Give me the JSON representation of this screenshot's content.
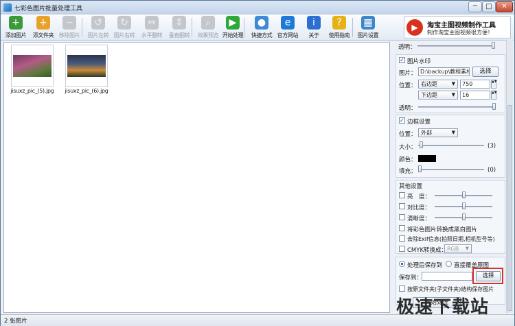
{
  "window": {
    "title": "七彩色图片批量处理工具",
    "min": "─",
    "max": "□",
    "close": "✕"
  },
  "toolbar": [
    {
      "label": "添加图片",
      "icon": "add-image-icon",
      "glyph": "+",
      "color": "#3a9a3a",
      "disabled": false
    },
    {
      "label": "添文件夹",
      "icon": "add-folder-icon",
      "glyph": "+",
      "color": "#e8a22a",
      "disabled": false
    },
    {
      "label": "移除图片",
      "icon": "remove-image-icon",
      "glyph": "−",
      "color": "#8a8f95",
      "disabled": true
    },
    {
      "label": "图片左转",
      "icon": "rotate-left-icon",
      "glyph": "↺",
      "color": "#8a8f95",
      "disabled": true
    },
    {
      "label": "图片右转",
      "icon": "rotate-right-icon",
      "glyph": "↻",
      "color": "#8a8f95",
      "disabled": true
    },
    {
      "label": "水平翻转",
      "icon": "flip-horizontal-icon",
      "glyph": "⇔",
      "color": "#8a8f95",
      "disabled": true
    },
    {
      "label": "垂直翻转",
      "icon": "flip-vertical-icon",
      "glyph": "⇕",
      "color": "#8a8f95",
      "disabled": true
    },
    {
      "label": "效果预览",
      "icon": "preview-icon",
      "glyph": "⌕",
      "color": "#8a8f95",
      "disabled": true
    },
    {
      "label": "开始处理",
      "icon": "start-icon",
      "glyph": "▶",
      "color": "#2fa83a",
      "disabled": false
    },
    {
      "label": "快捷方式",
      "icon": "shortcut-icon",
      "glyph": "●",
      "color": "#3d8ad6",
      "disabled": false
    },
    {
      "label": "官方网站",
      "icon": "website-icon",
      "glyph": "e",
      "color": "#1e7ad8",
      "disabled": false
    },
    {
      "label": "关于",
      "icon": "about-icon",
      "glyph": "i",
      "color": "#2b6fd1",
      "disabled": false
    },
    {
      "label": "使用指南",
      "icon": "guide-icon",
      "glyph": "?",
      "color": "#e6b117",
      "disabled": false
    },
    {
      "label": "图片设置",
      "icon": "image-settings-icon",
      "glyph": "▦",
      "color": "#3f86c9",
      "disabled": false
    }
  ],
  "promo": {
    "title": "淘宝主图视频制作工具",
    "subtitle": "制作淘宝主图视频很方便！"
  },
  "files": [
    {
      "name": "jisuxz_pic_(5).jpg"
    },
    {
      "name": "jisuxz_pic_(6).jpg"
    }
  ],
  "settings": {
    "top_opacity_label": "透明：",
    "top_opacity_level": 0.95,
    "watermark": {
      "title": "图片水印",
      "checked": true,
      "image_label": "图片：",
      "image_value": "D:\\backup\\教程素材",
      "select_label": "选择",
      "position_label": "位置：",
      "h_align": "右边距",
      "h_value": "750",
      "v_align": "下边距",
      "v_value": "16",
      "opacity_label": "透明：",
      "opacity_level": 0.95
    },
    "border": {
      "title": "边框设置",
      "checked": true,
      "position_label": "位置：",
      "position_value": "外部",
      "size_label": "大小：",
      "size_value": "(3)",
      "size_level": 0.03,
      "color_label": "颜色：",
      "color_hex": "#000000",
      "fill_label": "填充：",
      "fill_value": "(0)",
      "fill_level": 0.0
    },
    "other": {
      "title": "其他设置",
      "brightness": "亮　度：",
      "contrast": "对比度：",
      "sharpness": "清晰度：",
      "to_bw": "将彩色图片转换成黑白图片",
      "remove_exif": "去除Exif信息(拍照日期,相机型号等)",
      "cmyk": "CMYK转换成：",
      "cmyk_value": "RGB"
    },
    "output": {
      "save_after": "处理后保存到",
      "overwrite": "直接覆盖原图",
      "save_to_label": "保存到：",
      "select_label": "选择",
      "keep_structure": "按原文件夹(子文件夹)结构保存图片",
      "start_label": "开始处理"
    }
  },
  "status": {
    "count_text": "2 张图片"
  },
  "watermark_site": "极速下载站"
}
